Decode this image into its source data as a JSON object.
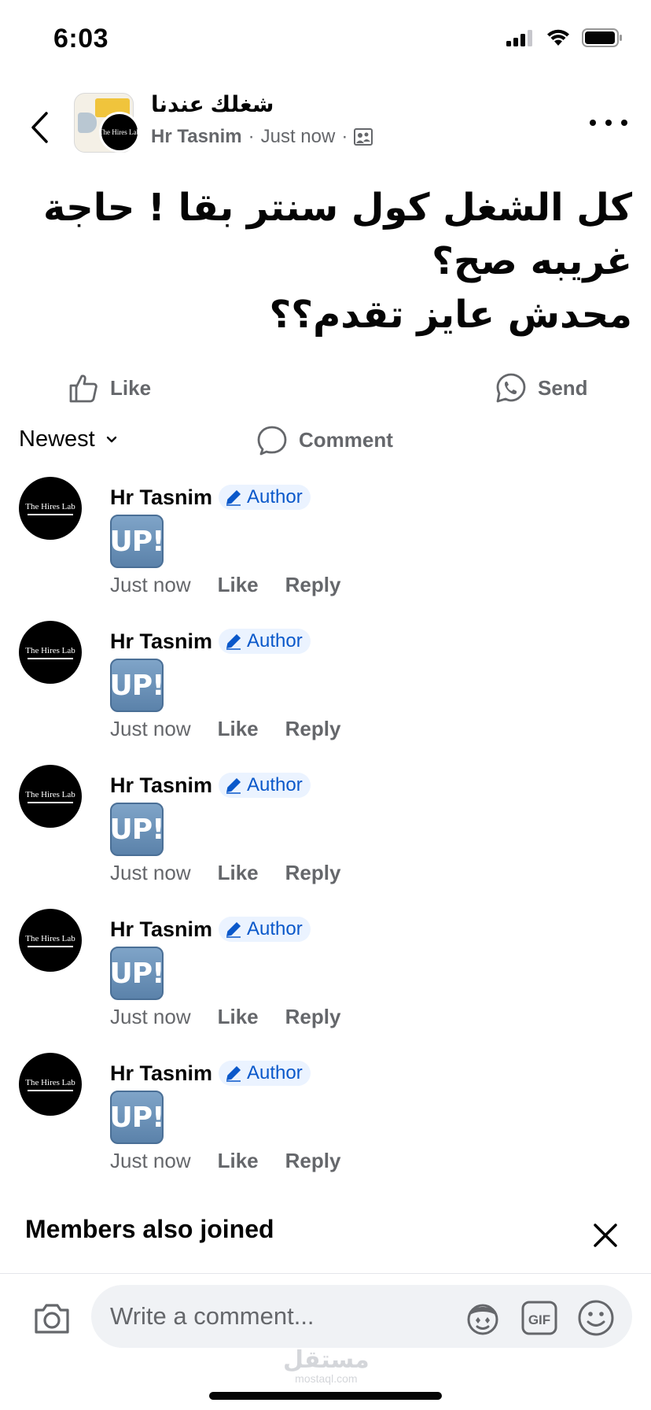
{
  "status_bar": {
    "time": "6:03",
    "icons": [
      "cellular-signal-icon",
      "wifi-icon",
      "battery-icon"
    ]
  },
  "header": {
    "group_name": "شغلك عندنا",
    "author": "Hr Tasnim",
    "separator": "·",
    "timestamp": "Just now",
    "privacy_icon": "group-members-icon",
    "avatar_brand": "The Hires Lab"
  },
  "post": {
    "text": "كل الشغل كول سنتر بقا ! حاجة\nغريبه صح؟\nمحدش عايز تقدم؟؟"
  },
  "actions": {
    "like_label": "Like",
    "comment_label": "Comment",
    "send_label": "Send"
  },
  "sort": {
    "label": "Newest"
  },
  "comments": [
    {
      "name": "Hr Tasnim",
      "badge": "Author",
      "sticker": "UP!",
      "time": "Just now",
      "like": "Like",
      "reply": "Reply"
    },
    {
      "name": "Hr Tasnim",
      "badge": "Author",
      "sticker": "UP!",
      "time": "Just now",
      "like": "Like",
      "reply": "Reply"
    },
    {
      "name": "Hr Tasnim",
      "badge": "Author",
      "sticker": "UP!",
      "time": "Just now",
      "like": "Like",
      "reply": "Reply"
    },
    {
      "name": "Hr Tasnim",
      "badge": "Author",
      "sticker": "UP!",
      "time": "Just now",
      "like": "Like",
      "reply": "Reply"
    },
    {
      "name": "Hr Tasnim",
      "badge": "Author",
      "sticker": "UP!",
      "time": "Just now",
      "like": "Like",
      "reply": "Reply"
    }
  ],
  "comment_avatar_brand": "The Hires Lab",
  "members": {
    "title": "Members also joined"
  },
  "composer": {
    "placeholder": "Write a comment...",
    "watermark_ar": "مستقل",
    "watermark_lat": "mostaql.com"
  },
  "colors": {
    "text": "#050505",
    "secondary": "#65676b",
    "badge_bg": "#ebf3ff",
    "badge_text": "#0a58ca",
    "input_bg": "#f0f2f5"
  }
}
